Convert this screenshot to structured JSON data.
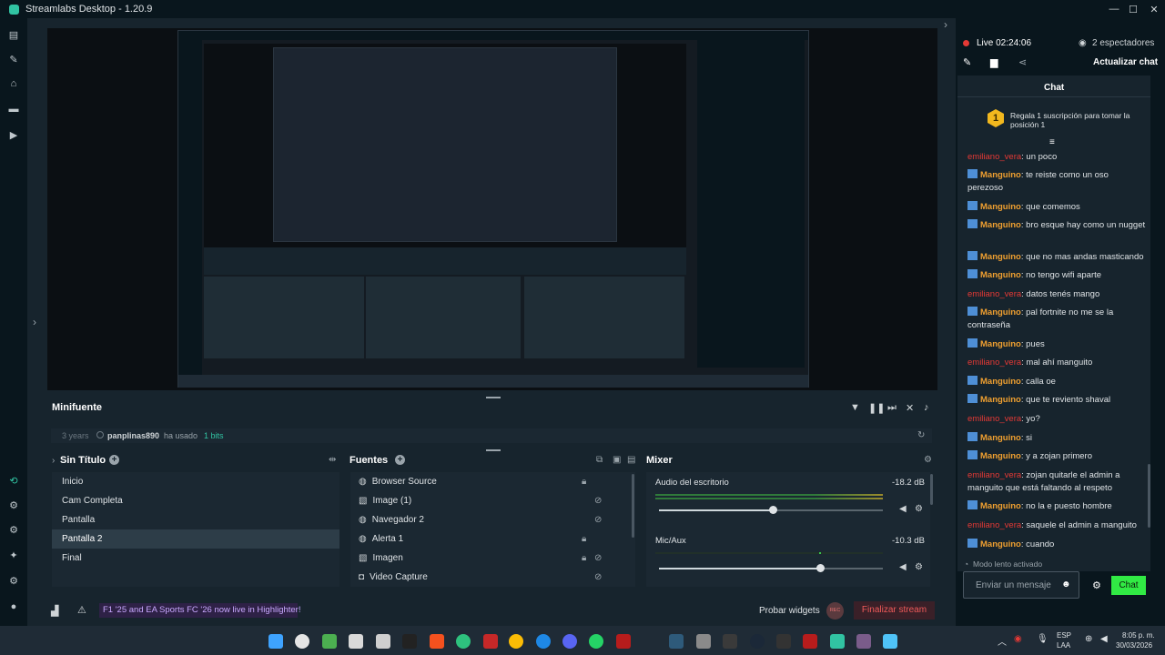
{
  "window": {
    "title": "Streamlabs Desktop - 1.20.9"
  },
  "minifuente": {
    "title": "Minifuente",
    "event": {
      "time": "3 years",
      "user": "panplinas890",
      "action": "ha usado",
      "amount": "1 bits"
    }
  },
  "scenes": {
    "title": "Sin Título",
    "items": [
      {
        "label": "Inicio"
      },
      {
        "label": "Cam Completa"
      },
      {
        "label": "Pantalla"
      },
      {
        "label": "Pantalla 2"
      },
      {
        "label": "Final"
      }
    ]
  },
  "sources": {
    "title": "Fuentes",
    "items": [
      {
        "label": "Browser Source"
      },
      {
        "label": "Image (1)"
      },
      {
        "label": "Navegador 2"
      },
      {
        "label": "Alerta 1"
      },
      {
        "label": "Imagen"
      },
      {
        "label": "Video Capture"
      }
    ]
  },
  "mixer": {
    "title": "Mixer",
    "channels": [
      {
        "name": "Audio del escritorio",
        "db": "-18.2 dB",
        "level": 0.51
      },
      {
        "name": "Mic/Aux",
        "db": "-10.3 dB",
        "level": 0.72
      }
    ]
  },
  "footer": {
    "banner": "F1 '25 and EA Sports FC '26 now live in Highlighter!",
    "test_widgets": "Probar widgets",
    "rec": "REC",
    "end_stream": "Finalizar stream"
  },
  "chat": {
    "live": "Live 02:24:06",
    "viewers": "2 espectadores",
    "refresh": "Actualizar chat",
    "title": "Chat",
    "pinned": "Regala 1 suscripción para tomar la posición 1",
    "slow_mode": "Modo lento activado",
    "placeholder": "Enviar un mensaje",
    "send": "Chat",
    "messages": [
      {
        "user": "emiliano_vera",
        "text": ": un poco"
      },
      {
        "user": "Manguino",
        "text": ": te reiste como un oso perezoso"
      },
      {
        "user": "Manguino",
        "text": ": que comemos"
      },
      {
        "user": "Manguino",
        "text": ": bro esque hay como un nugget"
      },
      {
        "user": "Manguino",
        "text": ": que no mas andas masticando"
      },
      {
        "user": "Manguino",
        "text": ": no tengo wifi aparte"
      },
      {
        "user": "emiliano_vera",
        "text": ": datos tenés mango"
      },
      {
        "user": "Manguino",
        "text": ": pal fortnite no me se la contraseña"
      },
      {
        "user": "Manguino",
        "text": ": pues"
      },
      {
        "user": "emiliano_vera",
        "text": ": mal ahí manguito"
      },
      {
        "user": "Manguino",
        "text": ": calla oe"
      },
      {
        "user": "Manguino",
        "text": ": que te reviento shaval"
      },
      {
        "user": "emiliano_vera",
        "text": ": yo?"
      },
      {
        "user": "Manguino",
        "text": ": si"
      },
      {
        "user": "Manguino",
        "text": ": y a zojan primero"
      },
      {
        "user": "emiliano_vera",
        "text": ": zojan quitarle el admin a manguito que está faltando al respeto"
      },
      {
        "user": "Manguino",
        "text": ": no la e puesto hombre"
      },
      {
        "user": "emiliano_vera",
        "text": ": saquele el admin a manguito"
      },
      {
        "user": "Manguino",
        "text": ": cuando"
      }
    ]
  },
  "taskbar": {
    "lang": "ESP",
    "region": "LAA",
    "time": "8:05 p. m.",
    "date": "30/03/2026"
  },
  "colors": {
    "accent": "#31c3a2",
    "chat_send": "#31ea44",
    "danger": "#e53935",
    "username": "#f0a030"
  }
}
